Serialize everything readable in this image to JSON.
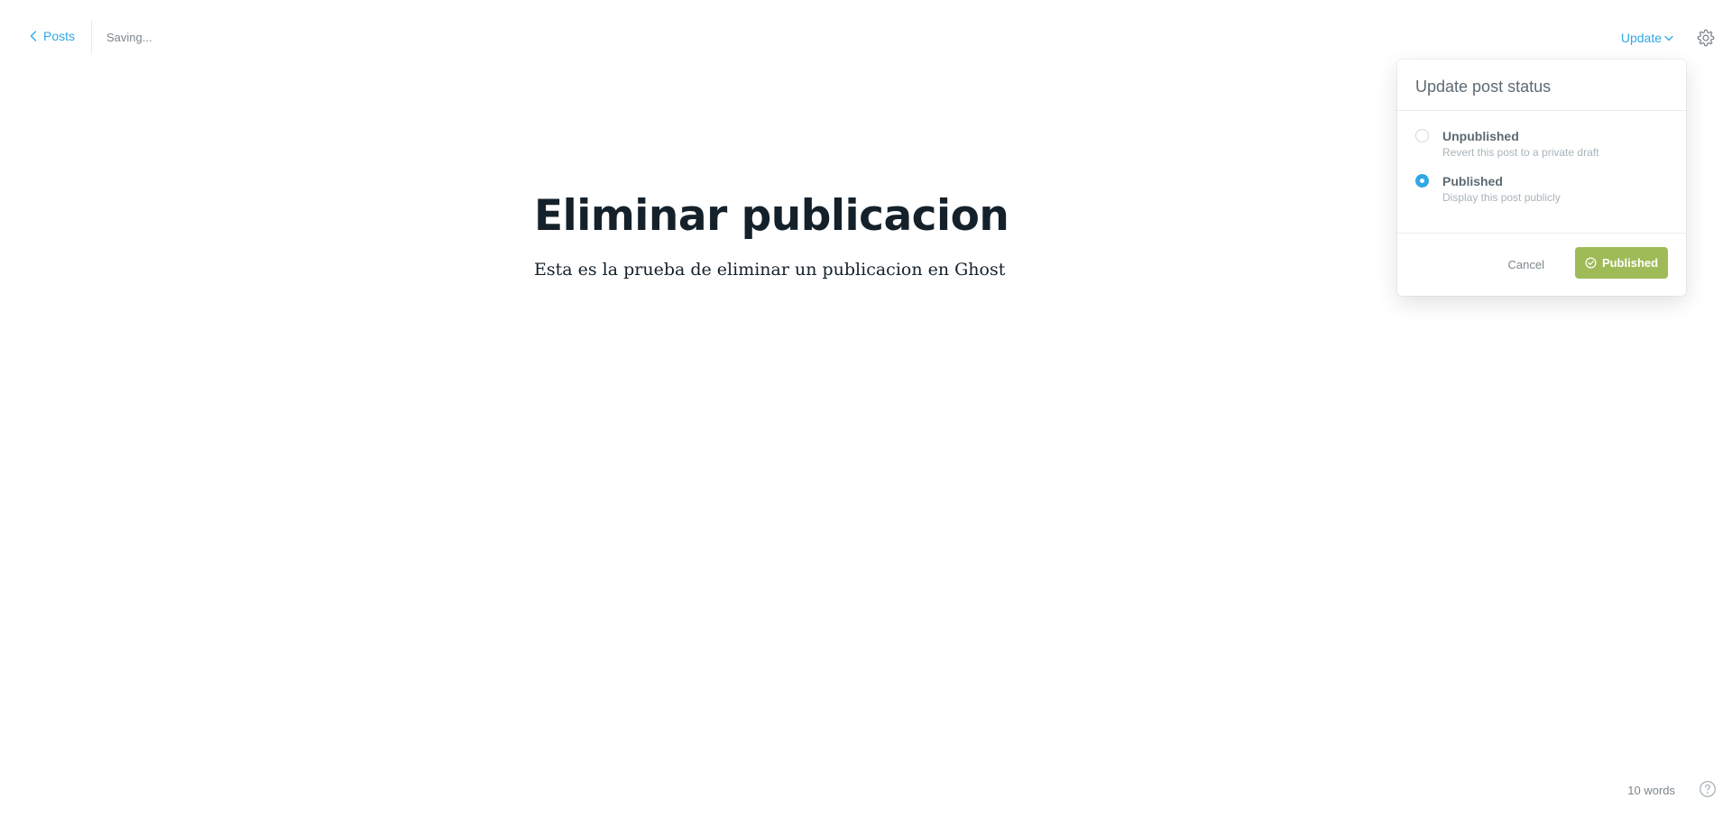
{
  "header": {
    "back_label": "Posts",
    "save_status": "Saving...",
    "update_label": "Update"
  },
  "editor": {
    "title": "Eliminar publicacion",
    "body": "Esta es la prueba de eliminar un publicacion en Ghost"
  },
  "popover": {
    "title": "Update post status",
    "options": [
      {
        "label": "Unpublished",
        "description": "Revert this post to a private draft",
        "selected": false
      },
      {
        "label": "Published",
        "description": "Display this post publicly",
        "selected": true
      }
    ],
    "cancel_label": "Cancel",
    "confirm_label": "Published"
  },
  "footer": {
    "word_count": "10 words"
  },
  "colors": {
    "accent": "#30a8e6",
    "published_button": "#9fbb58",
    "text": "#15212a",
    "muted": "#7d878d"
  },
  "icons": {
    "back": "chevron-left-icon",
    "update_dropdown": "chevron-down-icon",
    "settings": "gear-icon",
    "publish_check": "check-circle-icon",
    "help": "help-circle-icon"
  }
}
